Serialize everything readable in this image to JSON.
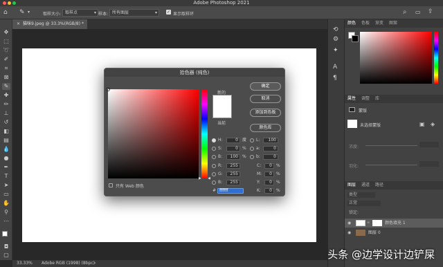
{
  "app": {
    "title": "Adobe Photoshop 2021"
  },
  "options_bar": {
    "sample_size_label": "取样大小:",
    "sample_size_value": "取样点",
    "sample_label": "样本:",
    "sample_value": "所有图层",
    "show_ring_label": "显示取样环"
  },
  "document": {
    "tab_label": "猫咪9.jpeg @ 33.3%(RGB/8) *"
  },
  "status": {
    "zoom": "33.33%",
    "profile": "Adobe RGB (1998) (8bpc)"
  },
  "color_panel": {
    "tabs": [
      "颜色",
      "色板",
      "渐变",
      "图案"
    ]
  },
  "properties_panel": {
    "tabs": [
      "属性",
      "调整",
      "库"
    ],
    "mask_label": "蒙版",
    "no_mask_label": "未选择蒙版",
    "density_label": "浓度:",
    "feather_label": "羽化:"
  },
  "layers_panel": {
    "tabs": [
      "图层",
      "通道",
      "路径"
    ],
    "kind_label": "类型",
    "blend_label": "正常",
    "lock_label": "锁定:",
    "layers": [
      {
        "name": "颜色填充 1"
      },
      {
        "name": "图层 0"
      }
    ]
  },
  "color_picker": {
    "title": "拾色器 (纯色)",
    "new_label": "新的",
    "current_label": "当前",
    "ok_label": "确定",
    "cancel_label": "取消",
    "add_swatch_label": "添加到色板",
    "libraries_label": "颜色库",
    "web_only_label": "只有 Web 颜色",
    "hsb": [
      {
        "label": "H:",
        "value": "0",
        "unit": "度"
      },
      {
        "label": "S:",
        "value": "0",
        "unit": "%"
      },
      {
        "label": "B:",
        "value": "100",
        "unit": "%"
      }
    ],
    "rgb": [
      {
        "label": "R:",
        "value": "255"
      },
      {
        "label": "G:",
        "value": "255"
      },
      {
        "label": "B:",
        "value": "255"
      }
    ],
    "lab": [
      {
        "label": "L:",
        "value": "100"
      },
      {
        "label": "a:",
        "value": "0"
      },
      {
        "label": "b:",
        "value": "0"
      }
    ],
    "cmyk": [
      {
        "label": "C:",
        "value": "0",
        "unit": "%"
      },
      {
        "label": "M:",
        "value": "0",
        "unit": "%"
      },
      {
        "label": "Y:",
        "value": "0",
        "unit": "%"
      },
      {
        "label": "K:",
        "value": "0",
        "unit": "%"
      }
    ],
    "hex_label": "#",
    "hex_value": "ffffff"
  },
  "watermark": "头条 @边学设计边铲屎",
  "colors": {
    "picker_hue": "#ff0000",
    "accent": "#2e6fd1"
  }
}
